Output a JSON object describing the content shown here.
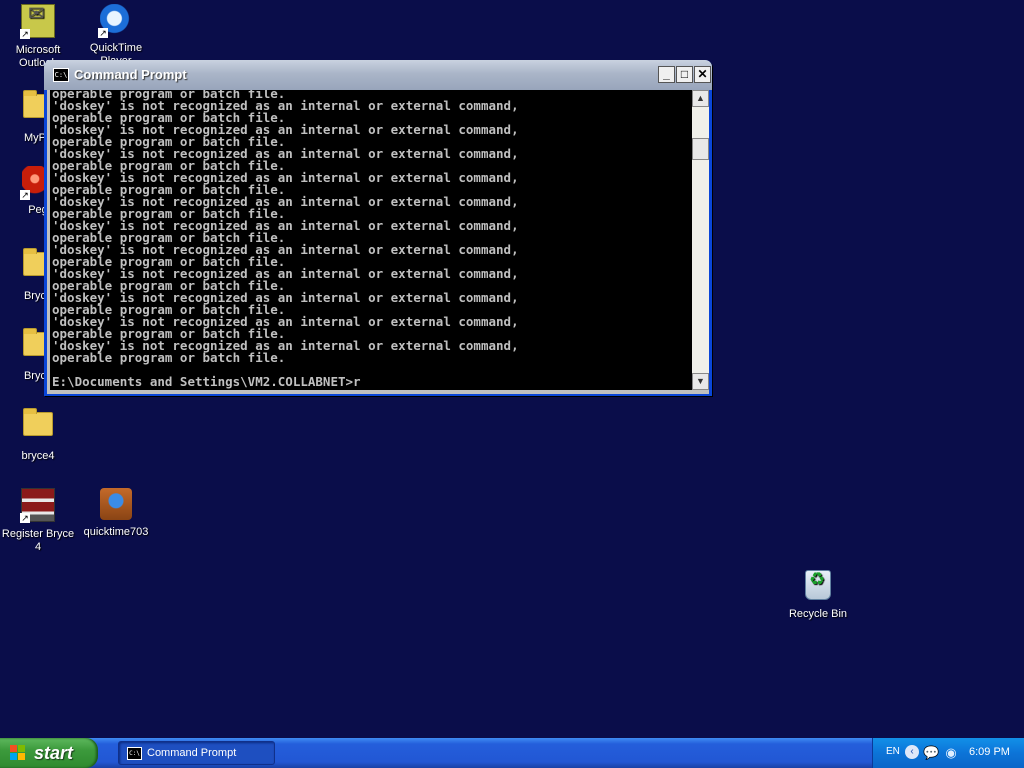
{
  "desktop": {
    "icons": [
      {
        "label": "Microsoft Outlook",
        "icon": "outlook-icon"
      },
      {
        "label": "QuickTime Player",
        "icon": "quicktime-icon"
      },
      {
        "label": "MyPa",
        "icon": "folder-icon"
      },
      {
        "label": "Peg",
        "icon": "app-red-icon"
      },
      {
        "label": "Bryce",
        "icon": "folder-icon"
      },
      {
        "label": "Bryce",
        "icon": "folder-icon"
      },
      {
        "label": "bryce4",
        "icon": "folder-icon"
      },
      {
        "label": "Register Bryce 4",
        "icon": "register-icon"
      },
      {
        "label": "quicktime703",
        "icon": "installer-icon"
      },
      {
        "label": "Recycle Bin",
        "icon": "recycle-bin-icon"
      }
    ]
  },
  "window": {
    "title": "Command Prompt",
    "icon_label": "C:\\",
    "minimize": "_",
    "maximize": "□",
    "close": "✕",
    "console_lines": [
      "operable program or batch file.",
      "'doskey' is not recognized as an internal or external command,",
      "operable program or batch file.",
      "'doskey' is not recognized as an internal or external command,",
      "operable program or batch file.",
      "'doskey' is not recognized as an internal or external command,",
      "operable program or batch file.",
      "'doskey' is not recognized as an internal or external command,",
      "operable program or batch file.",
      "'doskey' is not recognized as an internal or external command,",
      "operable program or batch file.",
      "'doskey' is not recognized as an internal or external command,",
      "operable program or batch file.",
      "'doskey' is not recognized as an internal or external command,",
      "operable program or batch file.",
      "'doskey' is not recognized as an internal or external command,",
      "operable program or batch file.",
      "'doskey' is not recognized as an internal or external command,",
      "operable program or batch file.",
      "'doskey' is not recognized as an internal or external command,",
      "operable program or batch file.",
      "'doskey' is not recognized as an internal or external command,",
      "operable program or batch file."
    ],
    "prompt": "E:\\Documents and Settings\\VM2.COLLABNET>r"
  },
  "taskbar": {
    "start_label": "start",
    "task_label": "Command Prompt",
    "language": "EN",
    "clock": "6:09 PM"
  },
  "colors": {
    "desktop": "#0a0d4a",
    "titlebar": "#aab5c8",
    "taskbar": "#245edb",
    "start": "#3c9a3c"
  }
}
